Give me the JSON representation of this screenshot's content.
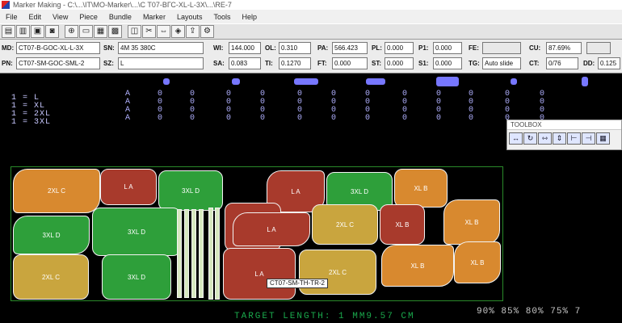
{
  "window": {
    "title": "Marker Making - C:\\...\\IT\\MO-Marker\\...\\C T07-ВГС-XL-L-3X\\...\\RE-7"
  },
  "menu": [
    "File",
    "Edit",
    "View",
    "Piece",
    "Bundle",
    "Marker",
    "Layouts",
    "Tools",
    "Help"
  ],
  "toolbar": {
    "icons": [
      "save-icon",
      "open-icon",
      "print-icon",
      "camera-icon",
      "zoom-icon",
      "window-icon",
      "layout-icon",
      "grid-icon",
      "bundle-icon",
      "cut-icon",
      "measure-icon",
      "piece-icon",
      "export-icon",
      "settings-icon"
    ]
  },
  "fields": {
    "row1": {
      "md_label": "MD:",
      "md_value": "CT07-B-GOC-XL-L-3X",
      "sn_label": "SN:",
      "sn_value": "4M 35 380C",
      "wi_label": "WI:",
      "wi_value": "144.000",
      "ol_label": "OL:",
      "ol_value": "0.310",
      "pa_label": "PA:",
      "pa_value": "566.423",
      "pl_label": "PL:",
      "pl_value": "0.000",
      "p1_label": "P1:",
      "p1_value": "0.000",
      "fe_label": "FE:",
      "fe_value": "",
      "cu_label": "CU:",
      "cu_value": "87.69%"
    },
    "row2": {
      "pn_label": "PN:",
      "pn_value": "CT07-SM-GOC-SML-2",
      "sz_label": "SZ:",
      "sz_value": "L",
      "sa_label": "SA:",
      "sa_value": "0.083",
      "ti_label": "TI:",
      "ti_value": "0.1270",
      "ft_label": "FT:",
      "ft_value": "0.000",
      "st_label": "ST:",
      "st_value": "0.000",
      "s1_label": "S1:",
      "s1_value": "0.000",
      "tg_label": "TG:",
      "tg_value": "Auto slide",
      "ct_label": "CT:",
      "ct_value": "0/76",
      "dd_label": "DD:",
      "dd_value": "0.125"
    }
  },
  "size_lines": [
    "1 = L",
    "1 = XL",
    "1 = 2XL",
    "1 = 3XL"
  ],
  "size_columns": [
    "A",
    "0",
    "0",
    "0",
    "0",
    "0",
    "0",
    "0",
    "0",
    "0",
    "0",
    "0",
    "0"
  ],
  "toolbox": {
    "title": "TOOLBOX",
    "icons": [
      "arrows-icon",
      "rotate-icon",
      "flip-h-icon",
      "flip-v-icon",
      "align-icon",
      "snap-icon",
      "lock-icon"
    ]
  },
  "marker": {
    "pieces": [
      {
        "label": "2XL  C",
        "color": "orange"
      },
      {
        "label": "L  A",
        "color": "red"
      },
      {
        "label": "3XL  D",
        "color": "green"
      },
      {
        "label": "L  A",
        "color": "red"
      },
      {
        "label": "3XL  D",
        "color": "green"
      },
      {
        "label": "XL  B",
        "color": "orange"
      },
      {
        "label": "3XL  D",
        "color": "green"
      },
      {
        "label": "3XL  D",
        "color": "green"
      },
      {
        "label": "XL  B",
        "color": "red"
      },
      {
        "label": "L  A",
        "color": "red"
      },
      {
        "label": "2XL  C",
        "color": "gold"
      },
      {
        "label": "XL  B",
        "color": "red"
      },
      {
        "label": "XL  B",
        "color": "orange"
      },
      {
        "label": "2XL  C",
        "color": "gold"
      },
      {
        "label": "3XL  D",
        "color": "green"
      },
      {
        "label": "XL  B",
        "color": "orange"
      },
      {
        "label": "L  A",
        "color": "red"
      },
      {
        "label": "2XL  C",
        "color": "gold"
      },
      {
        "label": "XL  B",
        "color": "orange"
      }
    ],
    "selected_label": "CT07-SM-TH-TR-2"
  },
  "status": {
    "target_length": "TARGET LENGTH:  1 MM9.57 CM",
    "percent_scale": "90%  85%  80%  75%  7"
  },
  "colors": {
    "background": "#000000",
    "green": "#2e9f3a",
    "orange": "#d8892f",
    "red": "#a83a2c",
    "gold": "#c9a53e",
    "status_green": "#1aa94c"
  }
}
